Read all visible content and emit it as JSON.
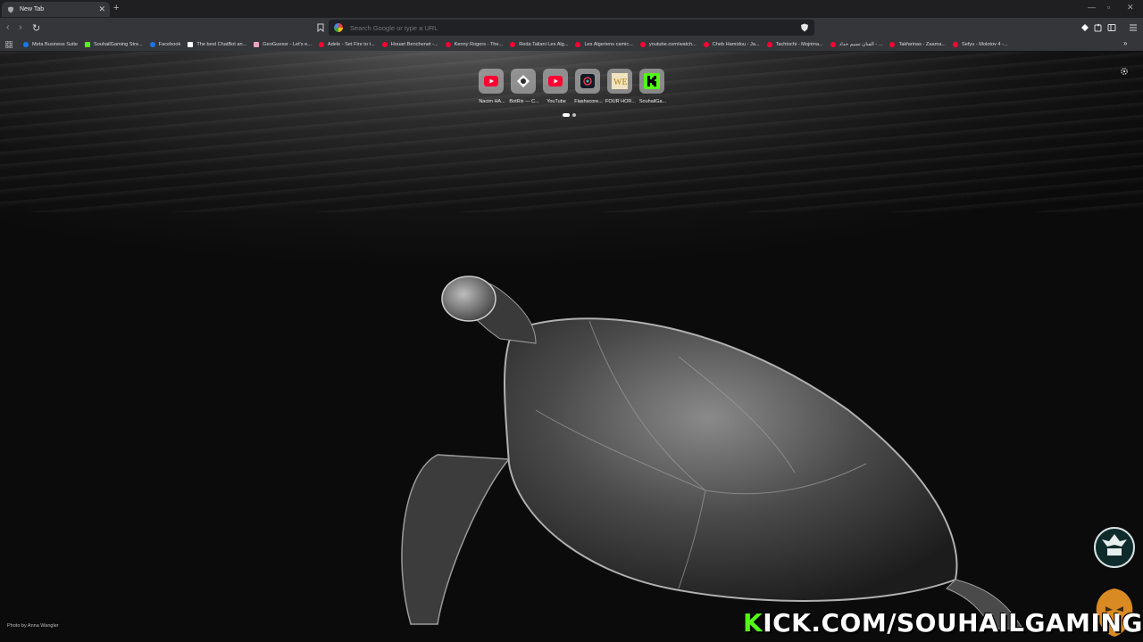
{
  "browser": {
    "tab_title": "New Tab",
    "new_tab_symbol": "+",
    "window_controls": [
      "—",
      "▫",
      "✕"
    ]
  },
  "toolbar": {
    "address_placeholder": "Search Google or type a URL"
  },
  "bookmarks": [
    {
      "label": "Meta Business Suite",
      "icon": "meta-icon",
      "color": "#1877f2"
    },
    {
      "label": "SouhailGaming Stre...",
      "icon": "kick-icon",
      "color": "#53fc18"
    },
    {
      "label": "Facebook",
      "icon": "facebook-icon",
      "color": "#1877f2"
    },
    {
      "label": "The best ChatBot an...",
      "icon": "diamond-icon",
      "color": "#ffffff"
    },
    {
      "label": "GeoGuessr - Let's e...",
      "icon": "pin-icon",
      "color": "#f0a0c0"
    },
    {
      "label": "Adele - Set Fire to t...",
      "icon": "youtube-icon",
      "color": "#ff0033"
    },
    {
      "label": "Houari Benchenet -...",
      "icon": "youtube-icon",
      "color": "#ff0033"
    },
    {
      "label": "Kenny Rogers - The...",
      "icon": "youtube-icon",
      "color": "#ff0033"
    },
    {
      "label": "Reda Taliani Les Alg...",
      "icon": "youtube-icon",
      "color": "#ff0033"
    },
    {
      "label": "Les Algeriens camic...",
      "icon": "youtube-icon",
      "color": "#ff0033"
    },
    {
      "label": "youtube.com/watch...",
      "icon": "youtube-icon",
      "color": "#ff0033"
    },
    {
      "label": "Cheb Hamidou - Ja...",
      "icon": "youtube-icon",
      "color": "#ff0033"
    },
    {
      "label": "Tachtochi - Mojrima...",
      "icon": "youtube-icon",
      "color": "#ff0033"
    },
    {
      "label": "الفنان تسيم حداد - ...",
      "icon": "youtube-icon",
      "color": "#ff0033"
    },
    {
      "label": "Takfarinas - Zaama...",
      "icon": "youtube-icon",
      "color": "#ff0033"
    },
    {
      "label": "Sefyu - Molotov 4 -...",
      "icon": "youtube-icon",
      "color": "#ff0033"
    }
  ],
  "bookmarks_overflow": "»",
  "shortcuts": [
    {
      "label": "Nacim HA...",
      "icon": "youtube-icon"
    },
    {
      "label": "BotRix — C...",
      "icon": "botrix-icon"
    },
    {
      "label": "YouTube",
      "icon": "youtube-icon"
    },
    {
      "label": "Flashscore...",
      "icon": "flashscore-icon"
    },
    {
      "label": "FOUR HOR...",
      "icon": "we-icon"
    },
    {
      "label": "SouhailGa...",
      "icon": "kick-icon"
    }
  ],
  "photo_credit": "Photo by Anna Wangler",
  "overlay": {
    "kick_first": "K",
    "kick_rest": "ICK.COM/SOUHAILGAMING"
  },
  "colors": {
    "kick_green": "#53fc18",
    "youtube_red": "#ff0033"
  }
}
